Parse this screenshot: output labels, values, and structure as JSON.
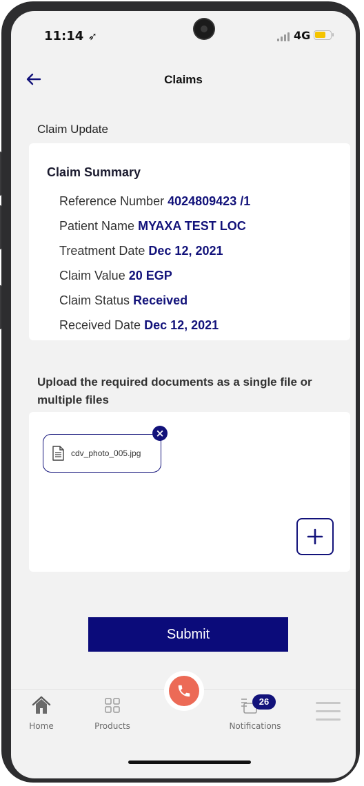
{
  "status_bar": {
    "time": "11:14",
    "network": "4G"
  },
  "nav": {
    "title": "Claims"
  },
  "section_heading": "Claim Update",
  "summary": {
    "title": "Claim Summary",
    "rows": [
      {
        "label": "Reference Number",
        "value": "4024809423 /1"
      },
      {
        "label": "Patient Name",
        "value": "MYAXA TEST LOC"
      },
      {
        "label": "Treatment Date",
        "value": "Dec 12, 2021"
      },
      {
        "label": "Claim Value",
        "value": "20 EGP"
      },
      {
        "label": "Claim Status",
        "value": "Received"
      },
      {
        "label": "Received Date",
        "value": "Dec 12, 2021"
      }
    ]
  },
  "upload": {
    "instruction": "Upload the required documents as a single file or multiple files",
    "files": [
      {
        "name": "cdv_photo_005.jpg"
      }
    ]
  },
  "submit_label": "Submit",
  "tabbar": {
    "home": "Home",
    "products": "Products",
    "notifications": "Notifications",
    "notification_count": "26"
  },
  "colors": {
    "accent": "#12127a",
    "submit": "#0b0b7a",
    "call": "#ec6a56",
    "battery": "#f5c400"
  }
}
